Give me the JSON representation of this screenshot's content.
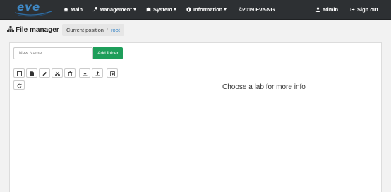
{
  "nav": {
    "main": "Main",
    "management": "Management",
    "system": "System",
    "information": "Information",
    "copyright": "©2019 Eve-NG",
    "user": "admin",
    "signout": "Sign out"
  },
  "logo": {
    "text": "eve"
  },
  "header": {
    "title": "File manager",
    "current_position": "Current position",
    "root": "root"
  },
  "panel": {
    "new_name_placeholder": "New Name",
    "add_folder": "Add folder",
    "info": "Choose a lab for more info"
  },
  "colors": {
    "navbar": "#2d3033",
    "accent_green": "#1e9e5a",
    "link_blue": "#3a87c8",
    "logo_blue": "#3f88c5"
  },
  "icons": [
    "home-icon",
    "wrench-icon",
    "book-icon",
    "info-circle-icon",
    "user-icon",
    "sign-out-icon",
    "sitemap-icon",
    "checkbox-icon",
    "file-icon",
    "pencil-icon",
    "scissors-icon",
    "trash-icon",
    "download-icon",
    "upload-icon",
    "export-icon",
    "refresh-icon"
  ]
}
